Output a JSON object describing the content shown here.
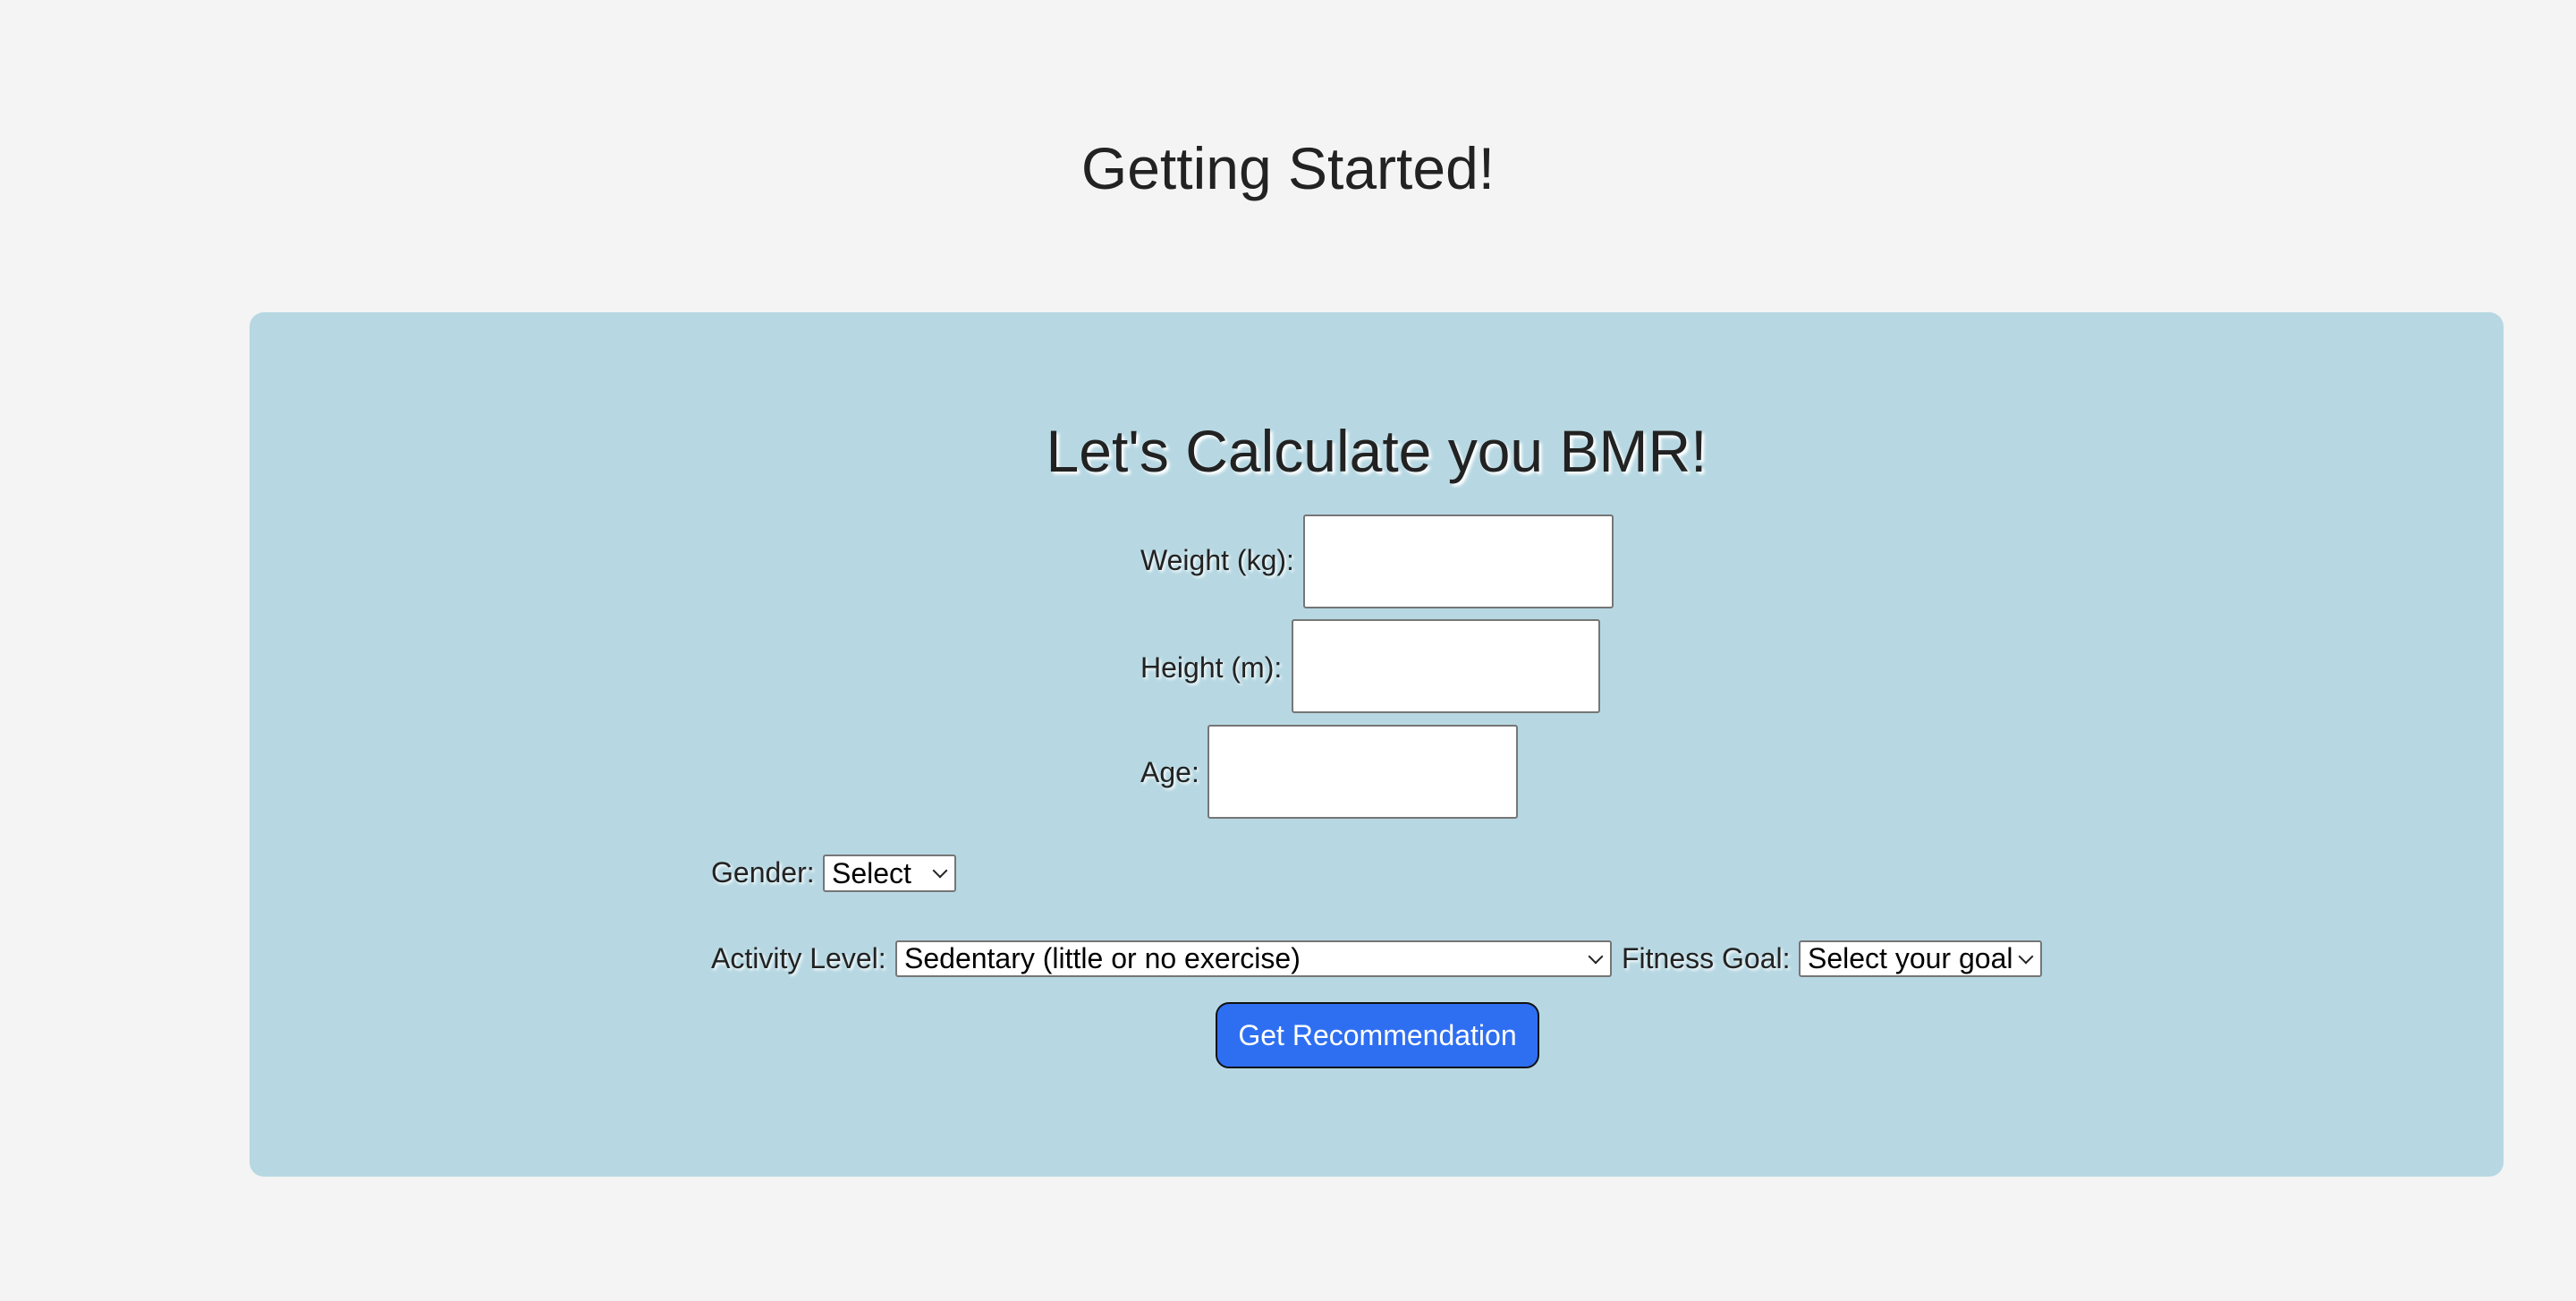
{
  "page_title": "Getting Started!",
  "card": {
    "title": "Let's Calculate you BMR!",
    "weight": {
      "label": "Weight (kg):",
      "value": ""
    },
    "height": {
      "label": "Height (m):",
      "value": ""
    },
    "age": {
      "label": "Age:",
      "value": ""
    },
    "gender": {
      "label": "Gender:",
      "selected": "Select"
    },
    "activity": {
      "label": "Activity Level:",
      "selected": "Sedentary (little or no exercise)"
    },
    "goal": {
      "label": "Fitness Goal:",
      "selected": "Select your goal"
    },
    "submit_label": "Get Recommendation"
  },
  "colors": {
    "background": "#f4f4f4",
    "panel": "#b7d8e3",
    "button": "#2e6ff2"
  }
}
